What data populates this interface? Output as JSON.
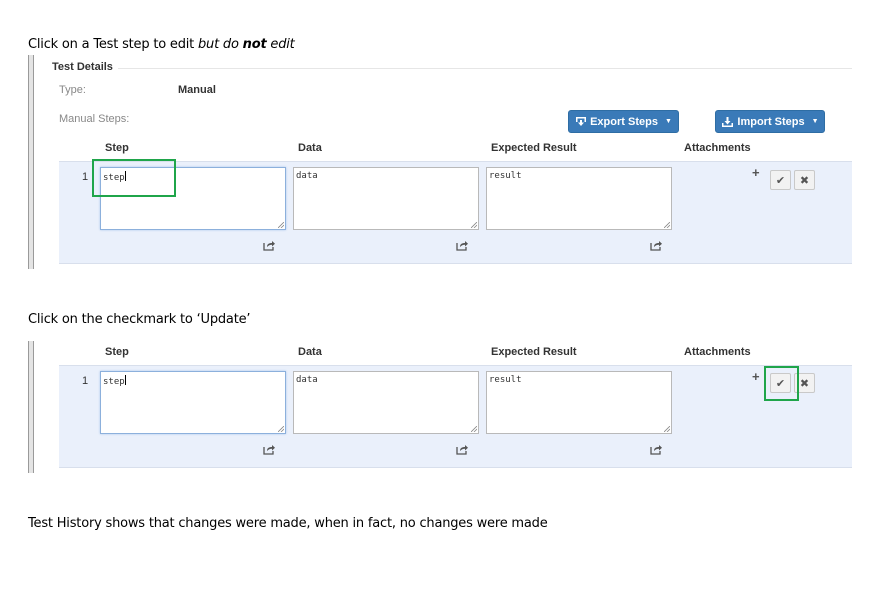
{
  "intro": {
    "part1": "Click on a Test step to edit ",
    "part2": "but do ",
    "part3": "not",
    "part4": " edit"
  },
  "details": {
    "title": "Test Details",
    "type_label": "Type:",
    "type_value": "Manual",
    "steps_label": "Manual Steps:",
    "export_label": "Export Steps",
    "import_label": "Import Steps"
  },
  "columns": {
    "step": "Step",
    "data": "Data",
    "expected": "Expected Result",
    "attachments": "Attachments"
  },
  "row": {
    "number": "1",
    "step": "step",
    "data": "data",
    "result": "result",
    "plus": "+",
    "check": "✔",
    "cancel": "✖"
  },
  "middle_text": "Click on the checkmark to ‘Update’",
  "footer_text": "Test History shows that changes were made, when in fact, no changes were made",
  "colors": {
    "button": "#3a7ab8",
    "row_background": "#eaf0fb",
    "highlight": "#1fa54a"
  },
  "icons": [
    "export-icon",
    "import-icon",
    "share-icon",
    "check-icon",
    "close-icon",
    "plus-icon"
  ]
}
